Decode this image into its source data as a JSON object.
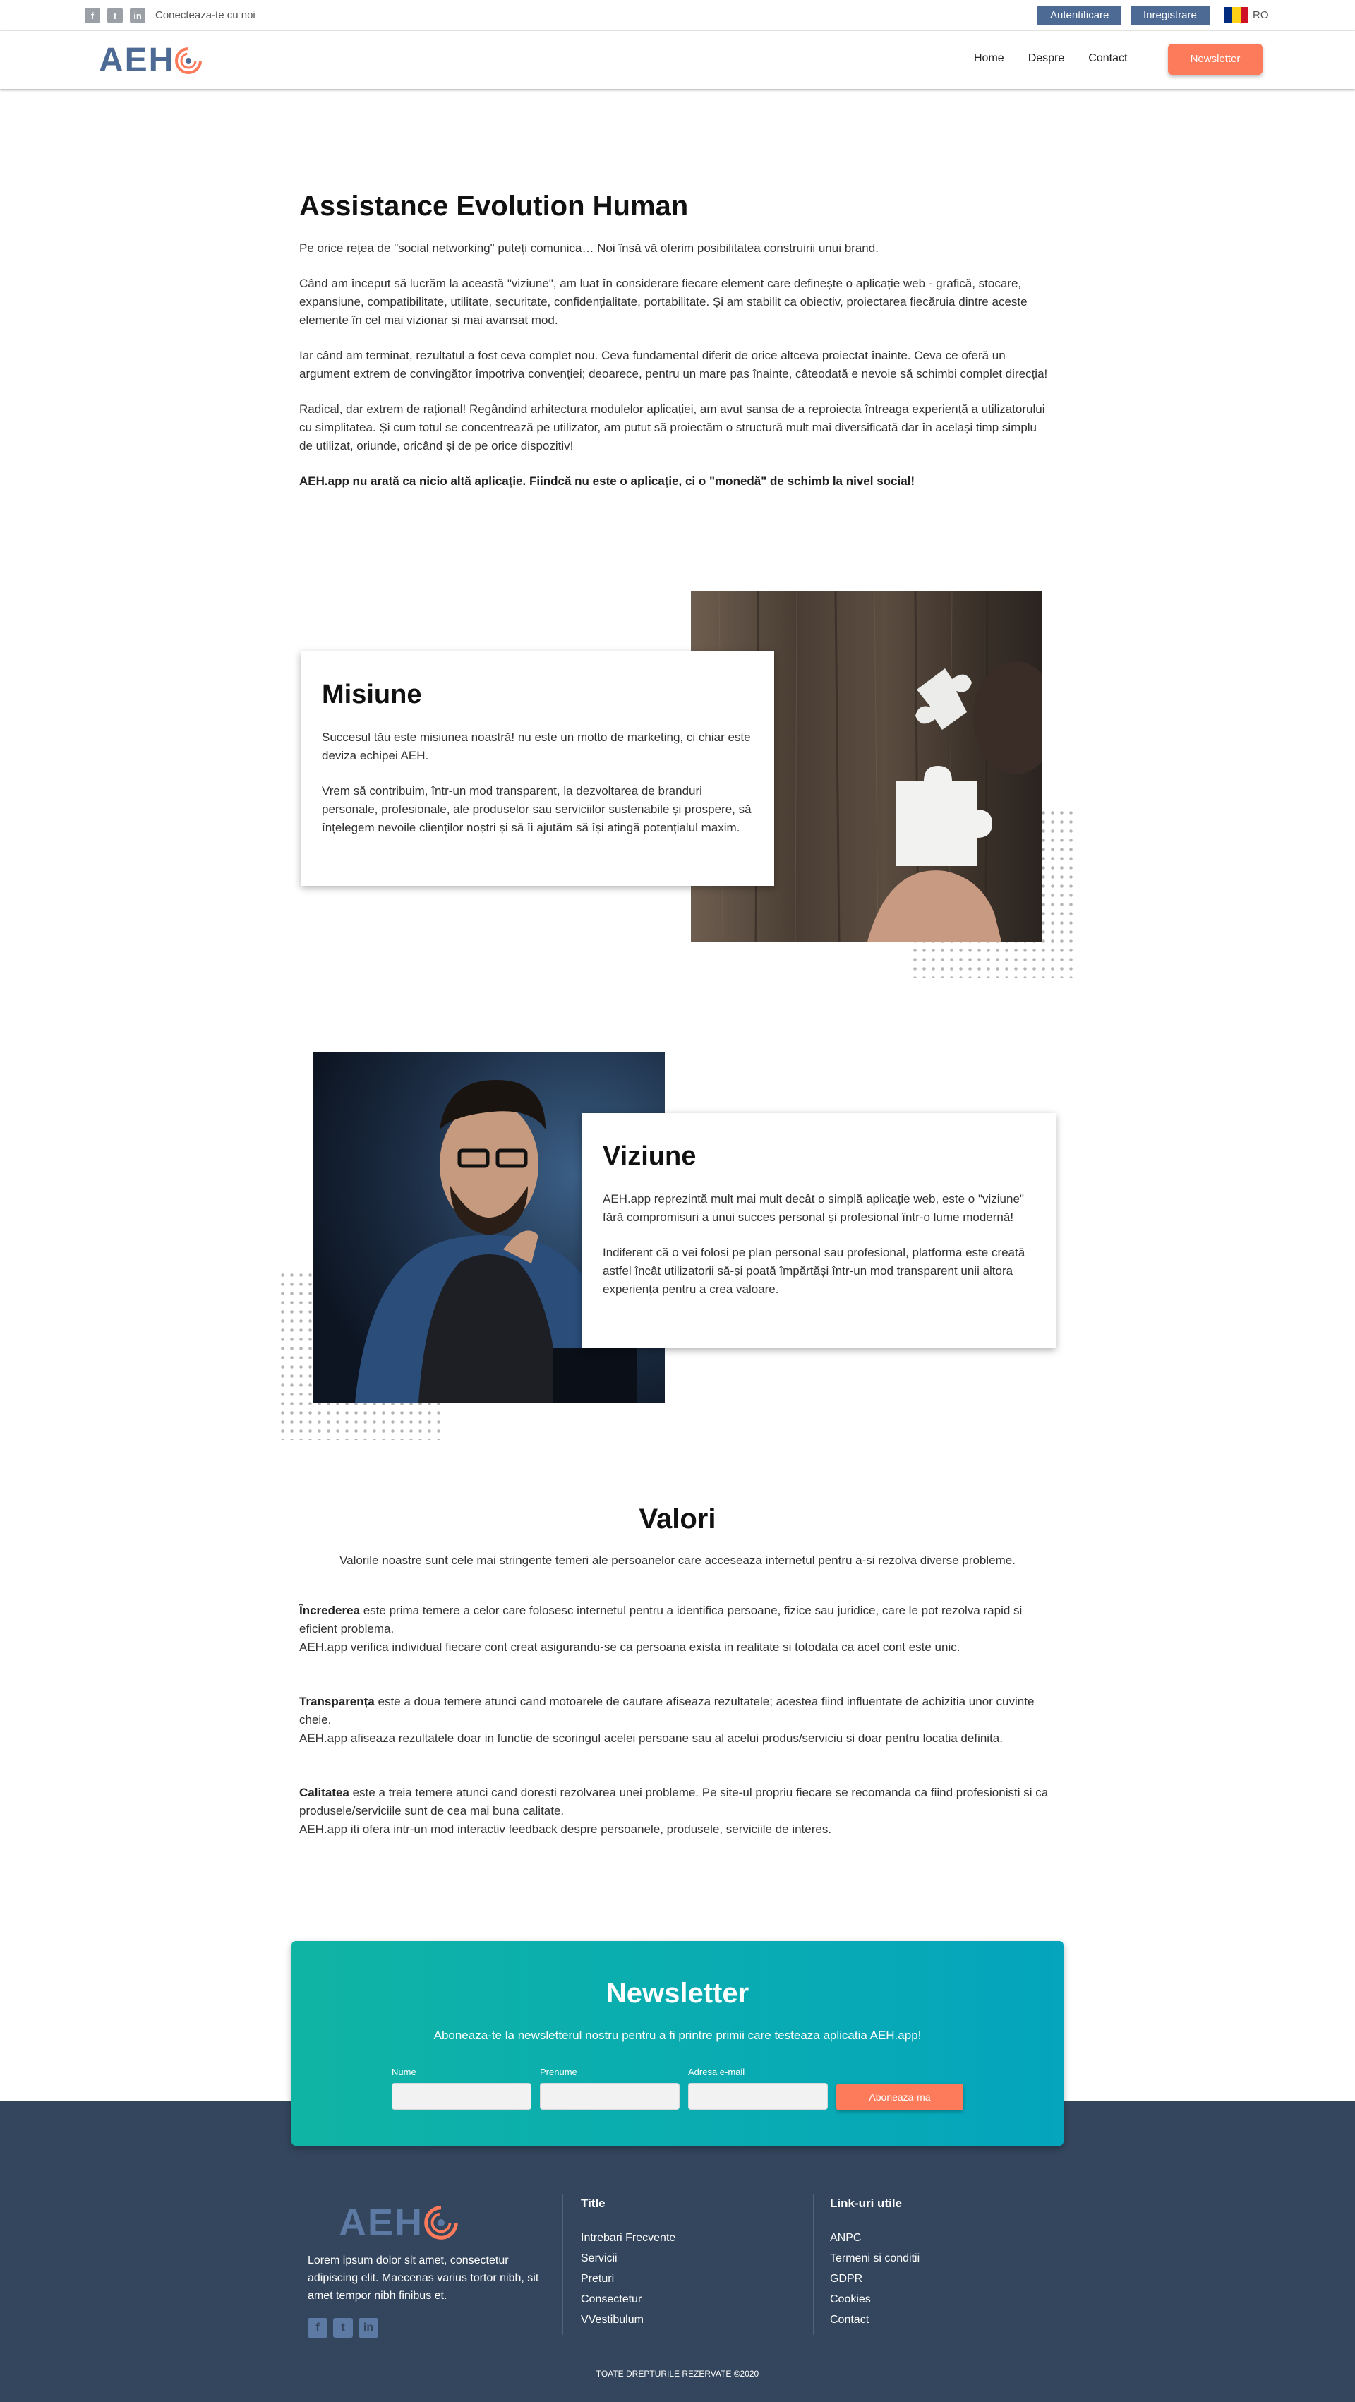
{
  "topbar": {
    "connect": "Conecteaza-te cu noi",
    "social_icons": [
      "facebook-icon",
      "twitter-icon",
      "linkedin-icon"
    ],
    "login": "Autentificare",
    "register": "Inregistrare",
    "lang": "RO"
  },
  "nav": {
    "logo": "AEH",
    "links": [
      "Home",
      "Despre",
      "Contact"
    ],
    "newsletter": "Newsletter"
  },
  "intro": {
    "title": "Assistance Evolution Human",
    "p1": "Pe orice rețea de \"social networking\" puteți comunica… Noi însă vă oferim posibilitatea construirii unui brand.",
    "p2": "Când am început să lucrăm la această \"viziune\", am luat în considerare fiecare element care definește o aplicație web - grafică, stocare, expansiune, compatibilitate, utilitate, securitate, confidențialitate, portabilitate. Și am stabilit ca obiectiv, proiectarea fiecăruia dintre aceste elemente în cel mai vizionar și mai avansat mod.",
    "p3": "Iar când am terminat, rezultatul a fost ceva complet nou. Ceva fundamental diferit de orice altceva proiectat înainte. Ceva ce oferă un argument extrem de convingător împotriva convenției; deoarece, pentru un mare pas înainte, câteodată e nevoie să schimbi complet direcția!",
    "p4": "Radical, dar extrem de rațional! Regândind arhitectura modulelor aplicației, am avut șansa de a reproiecta întreaga experiență a utilizatorului cu simplitatea. Și cum totul se concentrează pe utilizator, am putut să proiectăm o structură mult mai diversificată dar în același timp simplu de utilizat, oriunde, oricând și de pe orice dispozitiv!",
    "p5": "AEH.app nu arată ca nicio altă aplicație. Fiindcă nu este o aplicație, ci o \"monedă\" de schimb la nivel social!"
  },
  "mission": {
    "title": "Misiune",
    "p1": "Succesul tău este misiunea noastră! nu este un motto de marketing, ci chiar este deviza echipei AEH.",
    "p2": "Vrem să contribuim, într-un mod transparent, la dezvoltarea de branduri personale, profesionale, ale produselor sau serviciilor sustenabile și prospere, să înțelegem nevoile clienților noștri și să îi ajutăm să își atingă potențialul maxim."
  },
  "vision": {
    "title": "Viziune",
    "p1": "AEH.app reprezintă mult mai mult decât o simplă aplicație web, este o \"viziune\" fără compromisuri a unui succes personal și profesional într-o lume modernă!",
    "p2": "Indiferent că o vei folosi pe plan personal sau profesional, platforma este creată astfel încât utilizatorii să-și poată împărtăși într-un mod transparent unii altora experiența pentru a crea valoare."
  },
  "values": {
    "title": "Valori",
    "lead": "Valorile noastre sunt cele mai stringente temeri ale persoanelor care acceseaza internetul pentru a-si rezolva diverse probleme.",
    "items": [
      {
        "term": "Încrederea",
        "text": " este prima temere a celor care folosesc internetul pentru a identifica persoane, fizice sau juridice, care le pot rezolva rapid si eficient problema.",
        "text2": "AEH.app verifica individual fiecare cont creat asigurandu-se ca persoana exista in realitate si totodata ca acel cont este unic."
      },
      {
        "term": "Transparența",
        "text": " este a doua temere atunci cand motoarele de cautare afiseaza rezultatele; acestea fiind influentate de achizitia unor cuvinte cheie.",
        "text2": "AEH.app afiseaza rezultatele doar in functie de scoringul acelei persoane sau al acelui produs/serviciu si doar pentru locatia definita."
      },
      {
        "term": "Calitatea",
        "text": " este a treia temere atunci cand doresti rezolvarea unei probleme. Pe site-ul propriu fiecare se recomanda ca fiind profesionisti si ca produsele/serviciile sunt de cea mai buna calitate.",
        "text2": "AEH.app iti ofera intr-un mod interactiv feedback despre persoanele, produsele, serviciile de interes."
      }
    ]
  },
  "newsletter": {
    "title": "Newsletter",
    "subtitle": "Aboneaza-te la newsletterul nostru pentru a fi printre primii care testeaza aplicatia AEH.app!",
    "field_name": "Nume",
    "field_surname": "Prenume",
    "field_email": "Adresa e-mail",
    "button": "Aboneaza-ma"
  },
  "footer": {
    "logo": "AEH",
    "description": "Lorem ipsum dolor sit amet, consectetur adipiscing elit. Maecenas varius tortor nibh, sit amet tempor nibh finibus et.",
    "col1_title": "Title",
    "col1_links": [
      "Intrebari Frecvente",
      "Servicii",
      "Preturi",
      "Consectetur",
      "VVestibulum"
    ],
    "col2_title": "Link-uri utile",
    "col2_links": [
      "ANPC",
      "Termeni si conditii",
      "GDPR",
      "Cookies",
      "Contact"
    ],
    "copyright": "TOATE DREPTURILE REZERVATE ©2020"
  },
  "colors": {
    "brand_blue": "#4d6a94",
    "accent_orange": "#fd7a5a",
    "newsletter_teal": "#10b4a4",
    "footer_bg": "#34465d"
  }
}
